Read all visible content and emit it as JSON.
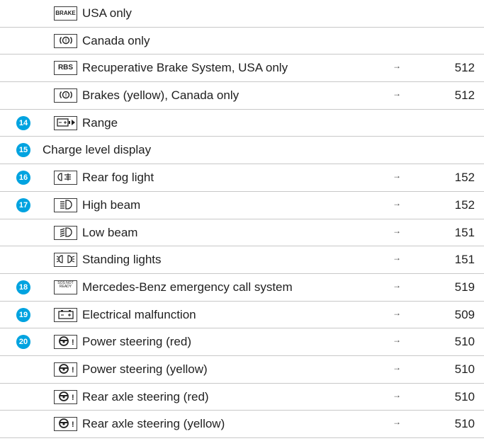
{
  "rows": [
    {
      "num": "",
      "icon": "brake-text-icon",
      "icon_text": "BRAKE",
      "label": "USA only",
      "page": ""
    },
    {
      "num": "",
      "icon": "brake-circle-icon",
      "icon_text": "",
      "label": "Canada only",
      "page": ""
    },
    {
      "num": "",
      "icon": "rbs-text-icon",
      "icon_text": "RBS",
      "label": "Recuperative Brake System, USA only",
      "page": "512"
    },
    {
      "num": "",
      "icon": "brake-circle-icon",
      "icon_text": "",
      "label": "Brakes (yellow), Canada only",
      "page": "512"
    },
    {
      "num": "14",
      "icon": "range-battery-icon",
      "icon_text": "",
      "label": "Range",
      "page": ""
    },
    {
      "num": "15",
      "icon": "",
      "icon_text": "",
      "label": "Charge level display",
      "page": ""
    },
    {
      "num": "16",
      "icon": "rear-fog-light-icon",
      "icon_text": "",
      "label": "Rear fog light",
      "page": "152"
    },
    {
      "num": "17",
      "icon": "high-beam-icon",
      "icon_text": "",
      "label": "High beam",
      "page": "152"
    },
    {
      "num": "",
      "icon": "low-beam-icon",
      "icon_text": "",
      "label": "Low beam",
      "page": "151"
    },
    {
      "num": "",
      "icon": "standing-lights-icon",
      "icon_text": "",
      "label": "Standing lights",
      "page": "151"
    },
    {
      "num": "18",
      "icon": "sos-not-ready-icon",
      "icon_text": "SOS NOT READY",
      "label": "Mercedes-Benz emergency call system",
      "page": "519"
    },
    {
      "num": "19",
      "icon": "battery-icon",
      "icon_text": "",
      "label": "Electrical malfunction",
      "page": "509"
    },
    {
      "num": "20",
      "icon": "steering-warning-icon",
      "icon_text": "!",
      "label": "Power steering (red)",
      "page": "510"
    },
    {
      "num": "",
      "icon": "steering-warning-icon",
      "icon_text": "!",
      "label": "Power steering (yellow)",
      "page": "510"
    },
    {
      "num": "",
      "icon": "steering-warning-icon",
      "icon_text": "!",
      "label": "Rear axle steering (red)",
      "page": "510"
    },
    {
      "num": "",
      "icon": "steering-warning-icon",
      "icon_text": "!",
      "label": "Rear axle steering (yellow)",
      "page": "510"
    }
  ],
  "arrow_glyph": "→",
  "colors": {
    "number_badge": "#00a3e0",
    "rule": "#c8c8c8",
    "text": "#1f1f1f"
  }
}
